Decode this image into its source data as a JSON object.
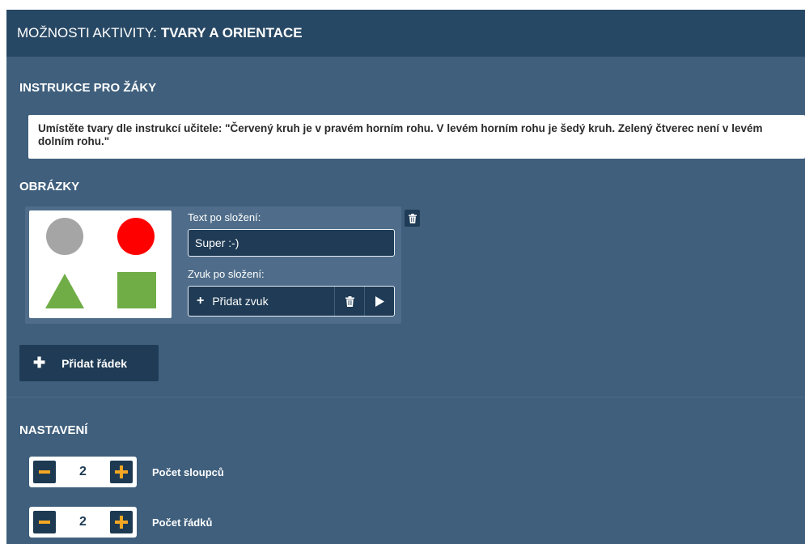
{
  "header": {
    "title_prefix": "MOŽNOSTI AKTIVITY:",
    "title_name": "TVARY A ORIENTACE"
  },
  "instructions": {
    "label": "INSTRUKCE PRO ŽÁKY",
    "text": "Umístěte tvary dle instrukcí učitele: \"Červený kruh je v pravém horním rohu. V levém horním rohu je šedý kruh. Zelený čtverec není v levém dolním rohu.\""
  },
  "images": {
    "label": "OBRÁZKY",
    "card": {
      "text_label": "Text po složení:",
      "text_value": "Super :-)",
      "sound_label": "Zvuk po složení:",
      "add_sound_label": "Přidat zvuk",
      "shapes": [
        {
          "name": "gray-circle-shape",
          "color": "#a5a5a5"
        },
        {
          "name": "red-circle-shape",
          "color": "#ff0000"
        },
        {
          "name": "green-triangle-shape",
          "color": "#70ad47"
        },
        {
          "name": "green-square-shape",
          "color": "#70ad47"
        }
      ]
    },
    "add_row_label": "Přidat řádek"
  },
  "settings": {
    "label": "NASTAVENÍ",
    "columns": {
      "value": "2",
      "label": "Počet sloupců"
    },
    "rows": {
      "value": "2",
      "label": "Počet řádků"
    }
  },
  "colors": {
    "panel_bg": "#3f5f7c",
    "header_bg": "#274864",
    "dark_button": "#1f3b55",
    "accent_yellow": "#f5a623"
  },
  "icons": {
    "plus": "plus-icon",
    "trash": "trash-icon",
    "play": "play-icon",
    "minus": "minus-icon"
  }
}
